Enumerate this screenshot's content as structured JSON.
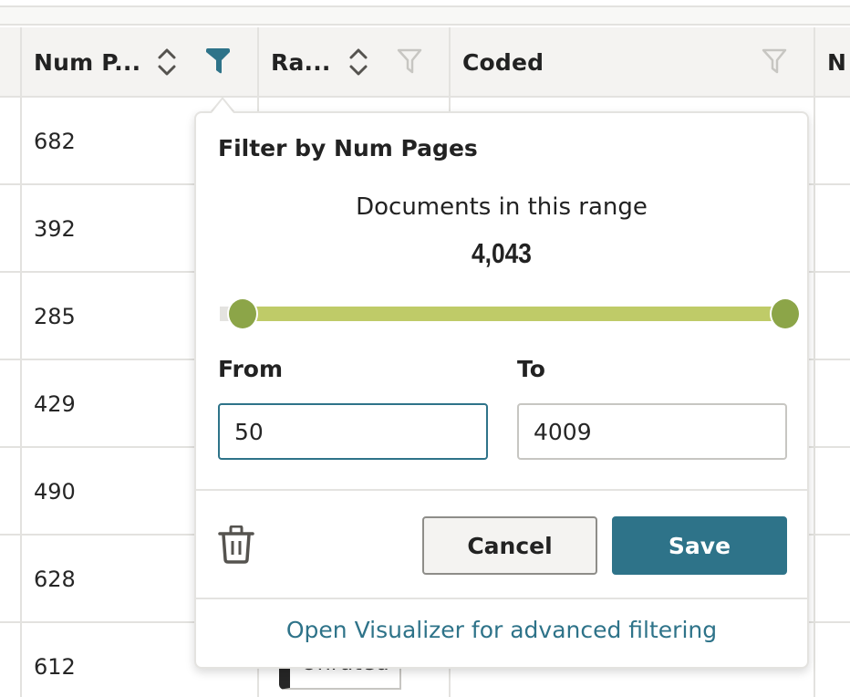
{
  "table": {
    "columns": [
      {
        "label": "Num P...",
        "sortable": true,
        "filter_active": true
      },
      {
        "label": "Ra...",
        "sortable": true,
        "filter_active": false
      },
      {
        "label": "Coded",
        "sortable": false,
        "filter_active": false
      },
      {
        "label": "N",
        "sortable": false,
        "filter_active": false
      }
    ],
    "rows": [
      {
        "num_pages": "682"
      },
      {
        "num_pages": "392"
      },
      {
        "num_pages": "285"
      },
      {
        "num_pages": "429"
      },
      {
        "num_pages": "490"
      },
      {
        "num_pages": "628"
      },
      {
        "num_pages": "612",
        "rating": "Unrated"
      }
    ]
  },
  "filter_popover": {
    "title": "Filter by Num Pages",
    "range_label": "Documents in this range",
    "range_count": "4,043",
    "slider": {
      "min_fraction": 0.04,
      "max_fraction": 1.0
    },
    "from_label": "From",
    "from_value": "50",
    "to_label": "To",
    "to_value": "4009",
    "delete_icon": "trash-icon",
    "cancel_label": "Cancel",
    "save_label": "Save",
    "visualizer_link": "Open Visualizer for advanced filtering"
  },
  "colors": {
    "accent": "#2e7389",
    "slider_fill": "#bfcb68",
    "slider_thumb": "#8ca548",
    "header_bg": "#f4f3f1",
    "border": "#e3e2df"
  }
}
